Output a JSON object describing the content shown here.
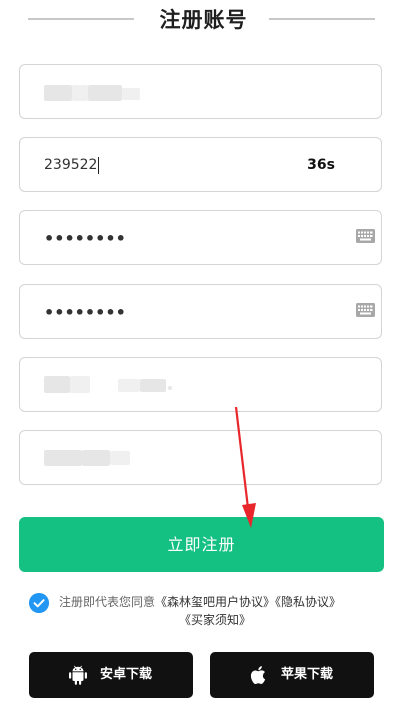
{
  "header": {
    "title": "注册账号"
  },
  "form": {
    "code_value": "239522",
    "countdown": "36s",
    "password_mask": "••••••••",
    "confirm_mask": "••••••••"
  },
  "submit_label": "立即注册",
  "agreement": {
    "checked": true,
    "prefix": "注册即代表您同意",
    "link1": "《森林玺吧用户协议》",
    "link2": "《隐私协议》",
    "link3": "《买家须知》"
  },
  "download": {
    "android_label": "安卓下载",
    "ios_label": "苹果下载"
  },
  "colors": {
    "primary": "#15c083",
    "check": "#2196f3",
    "download_bg": "#111111"
  }
}
